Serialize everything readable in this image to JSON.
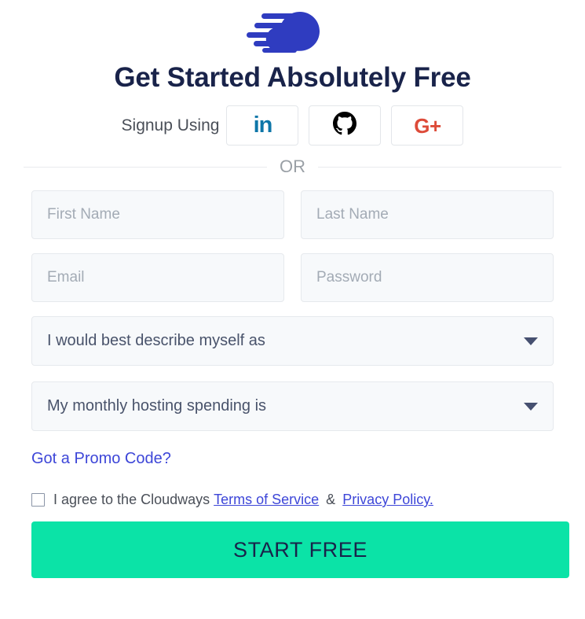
{
  "brand": {
    "logo_icon": "cloudways-cloud-logo",
    "logo_color": "#2f3cc0"
  },
  "header": {
    "title": "Get Started Absolutely Free"
  },
  "social": {
    "label": "Signup Using",
    "buttons": [
      {
        "name": "linkedin",
        "icon": "linkedin-icon",
        "glyph": "in",
        "color": "#0e76a8"
      },
      {
        "name": "github",
        "icon": "github-icon",
        "glyph": "",
        "color": "#000000"
      },
      {
        "name": "googleplus",
        "icon": "google-plus-icon",
        "glyph": "G+",
        "color": "#dd4b39"
      }
    ]
  },
  "divider": {
    "text": "OR"
  },
  "form": {
    "first_name": {
      "placeholder": "First Name",
      "value": ""
    },
    "last_name": {
      "placeholder": "Last Name",
      "value": ""
    },
    "email": {
      "placeholder": "Email",
      "value": ""
    },
    "password": {
      "placeholder": "Password",
      "value": ""
    },
    "describe_select": {
      "selected": "I would best describe myself as"
    },
    "spending_select": {
      "selected": "My monthly hosting spending is"
    },
    "promo_link": "Got a Promo Code?"
  },
  "terms": {
    "prefix": "I agree to the Cloudways",
    "terms_link": "Terms of Service",
    "separator": "&",
    "privacy_link": "Privacy Policy.",
    "checked": false
  },
  "cta": {
    "label": "START FREE",
    "color": "#0be3a7",
    "text_color": "#19234a"
  }
}
